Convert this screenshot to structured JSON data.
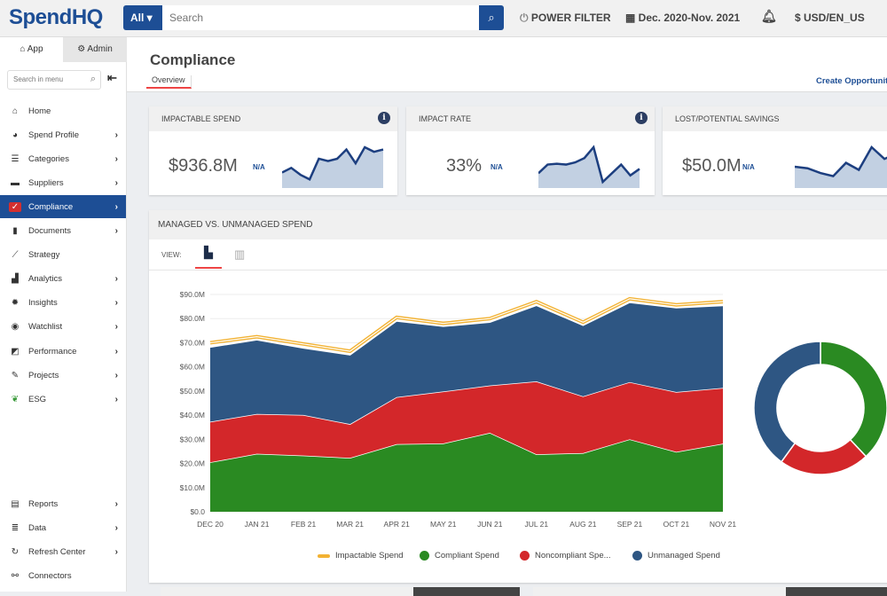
{
  "header": {
    "logo": "SpendHQ",
    "scope": "All ▾",
    "search_placeholder": "Search",
    "power_filter": "POWER FILTER",
    "date_range": "Dec. 2020-Nov. 2021",
    "currency": "$ USD/EN_US"
  },
  "sidebar": {
    "tabs": [
      "App",
      "Admin"
    ],
    "search_placeholder": "Search in menu",
    "items": [
      {
        "label": "Home",
        "icon": "home-icon",
        "g": "⌂",
        "chev": false
      },
      {
        "label": "Spend Profile",
        "icon": "pie-icon",
        "g": "◕",
        "chev": true
      },
      {
        "label": "Categories",
        "icon": "list-icon",
        "g": "☰",
        "chev": true
      },
      {
        "label": "Suppliers",
        "icon": "server-icon",
        "g": "▬",
        "chev": true
      },
      {
        "label": "Compliance",
        "icon": "clipboard-icon",
        "g": "✓",
        "chev": true,
        "active": true
      },
      {
        "label": "Documents",
        "icon": "file-icon",
        "g": "▮",
        "chev": true
      },
      {
        "label": "Strategy",
        "icon": "line-chart-icon",
        "g": "⟋",
        "chev": false
      },
      {
        "label": "Analytics",
        "icon": "bar-chart-icon",
        "g": "▟",
        "chev": true
      },
      {
        "label": "Insights",
        "icon": "lightbulb-icon",
        "g": "✹",
        "chev": true
      },
      {
        "label": "Watchlist",
        "icon": "eye-icon",
        "g": "◉",
        "chev": true
      },
      {
        "label": "Performance",
        "icon": "gauge-icon",
        "g": "◩",
        "chev": true
      },
      {
        "label": "Projects",
        "icon": "edit-icon",
        "g": "✎",
        "chev": true
      },
      {
        "label": "ESG",
        "icon": "leaf-icon",
        "g": "❦",
        "chev": true
      }
    ],
    "bottom_items": [
      {
        "label": "Reports",
        "icon": "report-icon",
        "g": "▤",
        "chev": true
      },
      {
        "label": "Data",
        "icon": "database-icon",
        "g": "≣",
        "chev": true
      },
      {
        "label": "Refresh Center",
        "icon": "refresh-icon",
        "g": "↻",
        "chev": true
      },
      {
        "label": "Connectors",
        "icon": "connectors-icon",
        "g": "⚯",
        "chev": false
      }
    ]
  },
  "page": {
    "title": "Compliance",
    "tab": "Overview",
    "create_link": "Create Opportunity"
  },
  "kpis": [
    {
      "label": "IMPACTABLE SPEND",
      "value": "$936.8M",
      "change": "N/A",
      "info": true,
      "spark": [
        3,
        4,
        2.5,
        1.5,
        6,
        5.5,
        6,
        8,
        5,
        8.5,
        7.5,
        8
      ]
    },
    {
      "label": "IMPACT RATE",
      "value": "33%",
      "change": "N/A",
      "info": true,
      "spark": [
        3,
        5,
        5.2,
        5,
        5.5,
        6.5,
        9,
        1,
        3,
        5,
        2.5,
        4
      ]
    },
    {
      "label": "LOST/POTENTIAL SAVINGS",
      "value": "$50.0M",
      "change": "N/A",
      "info": false,
      "spark": [
        5,
        4.6,
        3.4,
        2.6,
        6,
        4.2,
        10,
        7,
        8.5,
        9.5
      ]
    }
  ],
  "panel": {
    "title": "MANAGED VS. UNMANAGED SPEND",
    "view_label": "VIEW:"
  },
  "chart_data": [
    {
      "type": "area",
      "stacked": true,
      "categories": [
        "DEC 20",
        "JAN 21",
        "FEB 21",
        "MAR 21",
        "APR 21",
        "MAY 21",
        "JUN 21",
        "JUL 21",
        "AUG 21",
        "SEP 21",
        "OCT 21",
        "NOV 21"
      ],
      "yticks": [
        "$0.0",
        "$10.0M",
        "$20.0M",
        "$30.0M",
        "$40.0M",
        "$50.0M",
        "$60.0M",
        "$70.0M",
        "$80.0M",
        "$90.0M"
      ],
      "ylim": [
        0,
        90
      ],
      "grid": true,
      "legend": "bottom",
      "series": [
        {
          "name": "Compliant Spend",
          "color": "#2a8a22",
          "values": [
            20.5,
            24,
            23.3,
            22.3,
            28,
            28.3,
            32.7,
            23.8,
            24.3,
            30,
            24.8,
            28.2
          ]
        },
        {
          "name": "Noncompliant Spe...",
          "color": "#d3272a",
          "values": [
            16.8,
            16.5,
            16.8,
            14,
            19.5,
            21.5,
            19.6,
            30.2,
            23.5,
            23.7,
            24.8,
            23.1
          ]
        },
        {
          "name": "Unmanaged Spend",
          "color": "#2e5683",
          "values": [
            30.9,
            30.7,
            27.7,
            28.7,
            31.5,
            27,
            26.2,
            31.5,
            29.4,
            33,
            34.9,
            34.1
          ]
        }
      ],
      "line": {
        "name": "Impactable Spend",
        "color": "#f2b233",
        "values": [
          70,
          72.5,
          69.5,
          66.5,
          80.5,
          78,
          80,
          87,
          78.5,
          88.2,
          85.7,
          87
        ]
      }
    },
    {
      "type": "pie",
      "donut": true,
      "slices": [
        {
          "name": "Compliant Spend",
          "value": 38,
          "color": "#2a8a22"
        },
        {
          "name": "Noncompliant Spend",
          "value": 22,
          "color": "#d3272a"
        },
        {
          "name": "Unmanaged Spend",
          "value": 40,
          "color": "#2e5683"
        }
      ]
    }
  ]
}
